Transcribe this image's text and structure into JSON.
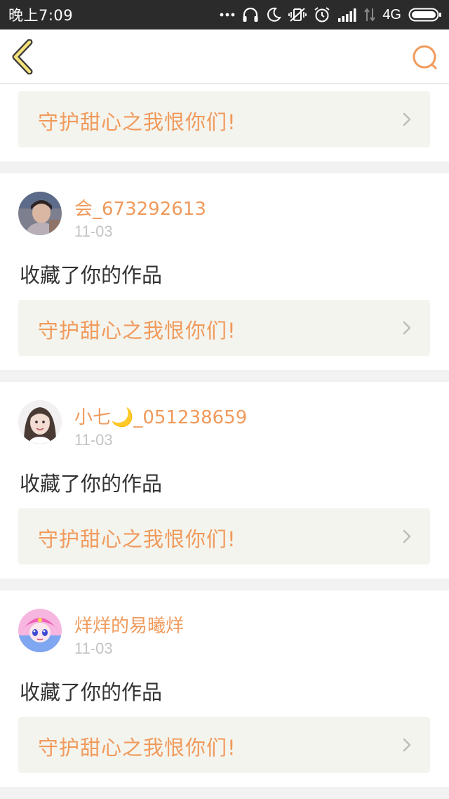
{
  "status_bar": {
    "time": "晚上7:09",
    "network": "4G"
  },
  "colors": {
    "accent": "#f09a5c",
    "status_bg": "#2b2b2b",
    "card_link_bg": "#f4f4ee",
    "date_gray": "#c4c4c4",
    "text_dark": "#333333",
    "page_bg": "#f2f2f2"
  },
  "nav": {
    "back_icon": "chevron-left-icon",
    "search_icon": "search-icon"
  },
  "feed": {
    "partial_item": {
      "work_title": "守护甜心之我恨你们!"
    },
    "items": [
      {
        "username": "会_673292613",
        "date": "11-03",
        "action": "收藏了你的作品",
        "work_title": "守护甜心之我恨你们!"
      },
      {
        "username": "小七🌙_051238659",
        "date": "11-03",
        "action": "收藏了你的作品",
        "work_title": "守护甜心之我恨你们!"
      },
      {
        "username": "烊烊的易曦烊",
        "date": "11-03",
        "action": "收藏了你的作品",
        "work_title": "守护甜心之我恨你们!"
      }
    ]
  }
}
